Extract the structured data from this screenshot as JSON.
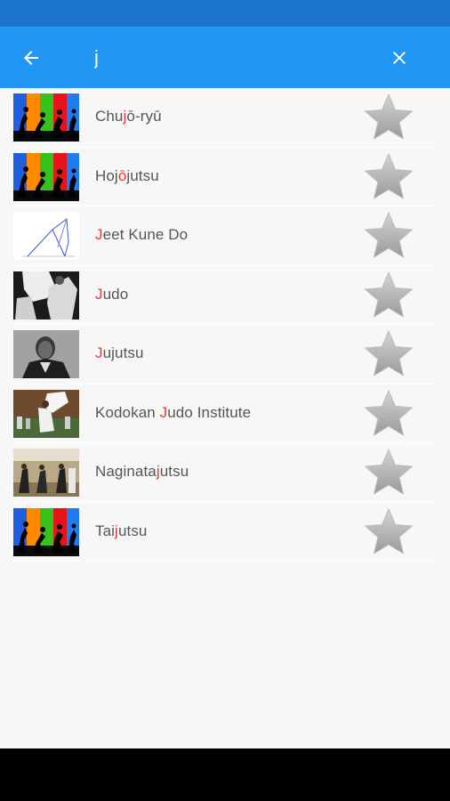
{
  "toolbar": {
    "back_icon": "arrow-left-icon",
    "search_value": "j",
    "clear_icon": "close-icon",
    "accent_color": "#2196f3",
    "status_color": "#1a74cc"
  },
  "results": {
    "highlight_color": "#e53935",
    "items": [
      {
        "pre": "Chu",
        "match": "j",
        "post": "ō-ryū",
        "thumb": "rainbow-silhouettes",
        "favorite_icon": "star-icon"
      },
      {
        "pre": "Hoj",
        "match": "ō",
        "post": "jutsu",
        "thumb": "rainbow-silhouettes",
        "favorite_icon": "star-icon"
      },
      {
        "pre": "",
        "match": "J",
        "post": "eet Kune Do",
        "thumb": "line-diagram",
        "favorite_icon": "star-icon"
      },
      {
        "pre": "",
        "match": "J",
        "post": "udo",
        "thumb": "judo-photo",
        "favorite_icon": "star-icon"
      },
      {
        "pre": "",
        "match": "J",
        "post": "ujutsu",
        "thumb": "portrait-photo",
        "favorite_icon": "star-icon"
      },
      {
        "pre": "Kodokan ",
        "match": "J",
        "post": "udo Institute",
        "thumb": "throw-photo",
        "favorite_icon": "star-icon"
      },
      {
        "pre": "Naginata",
        "match": "j",
        "post": "utsu",
        "thumb": "dojo-photo",
        "favorite_icon": "star-icon"
      },
      {
        "pre": "Tai",
        "match": "j",
        "post": "utsu",
        "thumb": "rainbow-silhouettes",
        "favorite_icon": "star-icon"
      }
    ]
  }
}
